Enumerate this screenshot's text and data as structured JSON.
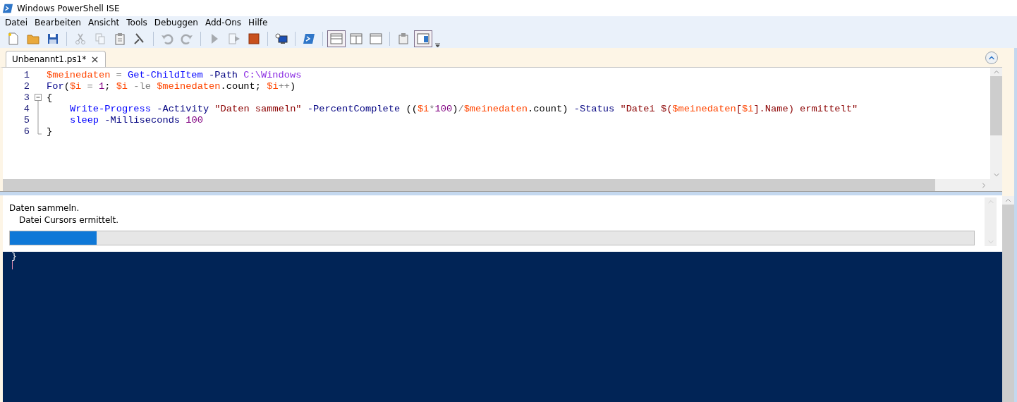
{
  "window": {
    "title": "Windows PowerShell ISE"
  },
  "menu": [
    {
      "label": "Datei"
    },
    {
      "label": "Bearbeiten"
    },
    {
      "label": "Ansicht"
    },
    {
      "label": "Tools"
    },
    {
      "label": "Debuggen"
    },
    {
      "label": "Add-Ons"
    },
    {
      "label": "Hilfe"
    }
  ],
  "toolbar": [
    {
      "kind": "new",
      "disabled": false,
      "selected": false
    },
    {
      "kind": "open",
      "disabled": false,
      "selected": false
    },
    {
      "kind": "save",
      "disabled": false,
      "selected": false
    },
    {
      "kind": "separator"
    },
    {
      "kind": "cut",
      "disabled": true,
      "selected": false
    },
    {
      "kind": "copy",
      "disabled": true,
      "selected": false
    },
    {
      "kind": "paste",
      "disabled": false,
      "selected": false
    },
    {
      "kind": "clear",
      "disabled": false,
      "selected": false
    },
    {
      "kind": "separator"
    },
    {
      "kind": "undo",
      "disabled": true,
      "selected": false
    },
    {
      "kind": "redo",
      "disabled": true,
      "selected": false
    },
    {
      "kind": "separator"
    },
    {
      "kind": "run",
      "disabled": true,
      "selected": false
    },
    {
      "kind": "runselection",
      "disabled": true,
      "selected": false
    },
    {
      "kind": "stop",
      "disabled": false,
      "selected": false
    },
    {
      "kind": "separator"
    },
    {
      "kind": "remote",
      "disabled": false,
      "selected": false
    },
    {
      "kind": "separator"
    },
    {
      "kind": "console",
      "disabled": false,
      "selected": false
    },
    {
      "kind": "separator"
    },
    {
      "kind": "layouttop",
      "disabled": false,
      "selected": true
    },
    {
      "kind": "layoutright",
      "disabled": false,
      "selected": false
    },
    {
      "kind": "layoutmax",
      "disabled": false,
      "selected": false
    },
    {
      "kind": "separator"
    },
    {
      "kind": "snippet",
      "disabled": false,
      "selected": false
    },
    {
      "kind": "showscript",
      "disabled": false,
      "selected": true
    }
  ],
  "tabs": [
    {
      "label": "Unbenannt1.ps1*",
      "selected": true
    }
  ],
  "editor": {
    "lines": [
      {
        "number": "1",
        "kind": "plain",
        "indented": false,
        "tokens": [
          {
            "kind": "var",
            "text": "$meinedaten"
          },
          {
            "kind": "op",
            "text": " = "
          },
          {
            "kind": "cmd",
            "text": "Get-ChildItem"
          },
          {
            "kind": "param",
            "text": " -Path "
          },
          {
            "kind": "arg",
            "text": "C:\\Windows"
          }
        ]
      },
      {
        "number": "2",
        "kind": "plain",
        "indented": false,
        "tokens": [
          {
            "kind": "kw",
            "text": "For"
          },
          {
            "kind": "plain",
            "text": "("
          },
          {
            "kind": "var",
            "text": "$i"
          },
          {
            "kind": "op",
            "text": " = "
          },
          {
            "kind": "num",
            "text": "1"
          },
          {
            "kind": "plain",
            "text": "; "
          },
          {
            "kind": "var",
            "text": "$i"
          },
          {
            "kind": "op",
            "text": " -le "
          },
          {
            "kind": "var",
            "text": "$meinedaten"
          },
          {
            "kind": "plain",
            "text": ".count; "
          },
          {
            "kind": "var",
            "text": "$i"
          },
          {
            "kind": "op",
            "text": "++"
          },
          {
            "kind": "plain",
            "text": ")"
          }
        ]
      },
      {
        "number": "3",
        "kind": "fold_start",
        "indented": false,
        "tokens": [
          {
            "kind": "plain",
            "text": "{"
          }
        ]
      },
      {
        "number": "4",
        "kind": "fold_inner",
        "indented": true,
        "tokens": [
          {
            "kind": "cmd",
            "text": "Write-Progress"
          },
          {
            "kind": "param",
            "text": " -Activity "
          },
          {
            "kind": "str",
            "text": "\"Daten sammeln\""
          },
          {
            "kind": "param",
            "text": " -PercentComplete "
          },
          {
            "kind": "plain",
            "text": "(("
          },
          {
            "kind": "var",
            "text": "$i"
          },
          {
            "kind": "op",
            "text": "*"
          },
          {
            "kind": "num",
            "text": "100"
          },
          {
            "kind": "plain",
            "text": ")"
          },
          {
            "kind": "op",
            "text": "/"
          },
          {
            "kind": "var",
            "text": "$meinedaten"
          },
          {
            "kind": "plain",
            "text": ".count)"
          },
          {
            "kind": "param",
            "text": " -Status "
          },
          {
            "kind": "str",
            "text": "\"Datei $("
          },
          {
            "kind": "var",
            "text": "$meinedaten"
          },
          {
            "kind": "str",
            "text": "["
          },
          {
            "kind": "var",
            "text": "$i"
          },
          {
            "kind": "str",
            "text": "].Name) ermittelt\""
          }
        ]
      },
      {
        "number": "5",
        "kind": "fold_inner",
        "indented": true,
        "tokens": [
          {
            "kind": "cmd",
            "text": "sleep"
          },
          {
            "kind": "param",
            "text": " -Milliseconds "
          },
          {
            "kind": "num",
            "text": "100"
          }
        ]
      },
      {
        "number": "6",
        "kind": "fold_end",
        "indented": false,
        "tokens": [
          {
            "kind": "plain",
            "text": "}"
          }
        ]
      }
    ]
  },
  "progress": {
    "activity": "Daten sammeln.",
    "status": "Datei Cursors ermittelt.",
    "level": 0.09
  },
  "console": {
    "lines": [
      "}"
    ]
  }
}
